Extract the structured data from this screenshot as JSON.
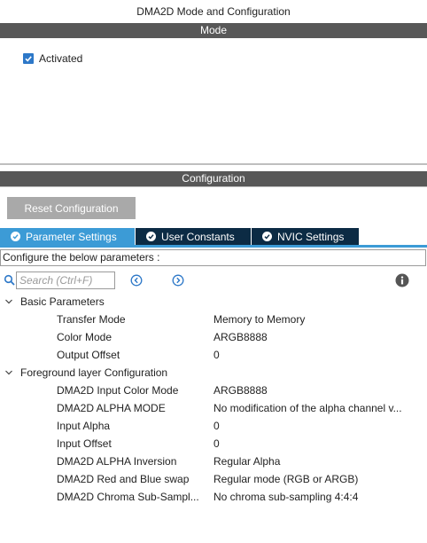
{
  "window": {
    "title": "DMA2D Mode and Configuration"
  },
  "mode": {
    "header": "Mode",
    "activated": {
      "label": "Activated",
      "checked": true
    }
  },
  "config": {
    "header": "Configuration",
    "reset_label": "Reset Configuration",
    "tabs": [
      {
        "label": "Parameter Settings",
        "active": true
      },
      {
        "label": "User Constants",
        "active": false
      },
      {
        "label": "NVIC Settings",
        "active": false
      }
    ],
    "configure_text": "Configure the below parameters :",
    "search": {
      "placeholder": "Search (Ctrl+F)",
      "value": ""
    },
    "groups": [
      {
        "label": "Basic Parameters",
        "expanded": true,
        "params": [
          {
            "name": "Transfer Mode",
            "value": "Memory to Memory"
          },
          {
            "name": "Color Mode",
            "value": "ARGB8888"
          },
          {
            "name": "Output Offset",
            "value": "0"
          }
        ]
      },
      {
        "label": "Foreground layer Configuration",
        "expanded": true,
        "params": [
          {
            "name": "DMA2D Input Color Mode",
            "value": "ARGB8888"
          },
          {
            "name": "DMA2D ALPHA MODE",
            "value": "No modification of the alpha channel v..."
          },
          {
            "name": "Input Alpha",
            "value": "0"
          },
          {
            "name": "Input Offset",
            "value": "0"
          },
          {
            "name": "DMA2D ALPHA Inversion",
            "value": "Regular Alpha"
          },
          {
            "name": "DMA2D Red and Blue swap",
            "value": "Regular mode (RGB or ARGB)"
          },
          {
            "name": "DMA2D Chroma Sub-Sampl...",
            "value": "No chroma sub-sampling 4:4:4"
          }
        ]
      }
    ]
  },
  "colors": {
    "section_bar": "#585858",
    "tab_active": "#3c9bd6",
    "tab_inactive": "#0c2b44",
    "checkbox": "#2d78c8",
    "reset_button": "#a9a9a9"
  },
  "icons": {
    "search": "search-icon",
    "prev": "chevron-left-circle-icon",
    "next": "chevron-right-circle-icon",
    "info": "info-icon",
    "tab": "check-circle-icon",
    "group": "chevron-down-icon"
  }
}
